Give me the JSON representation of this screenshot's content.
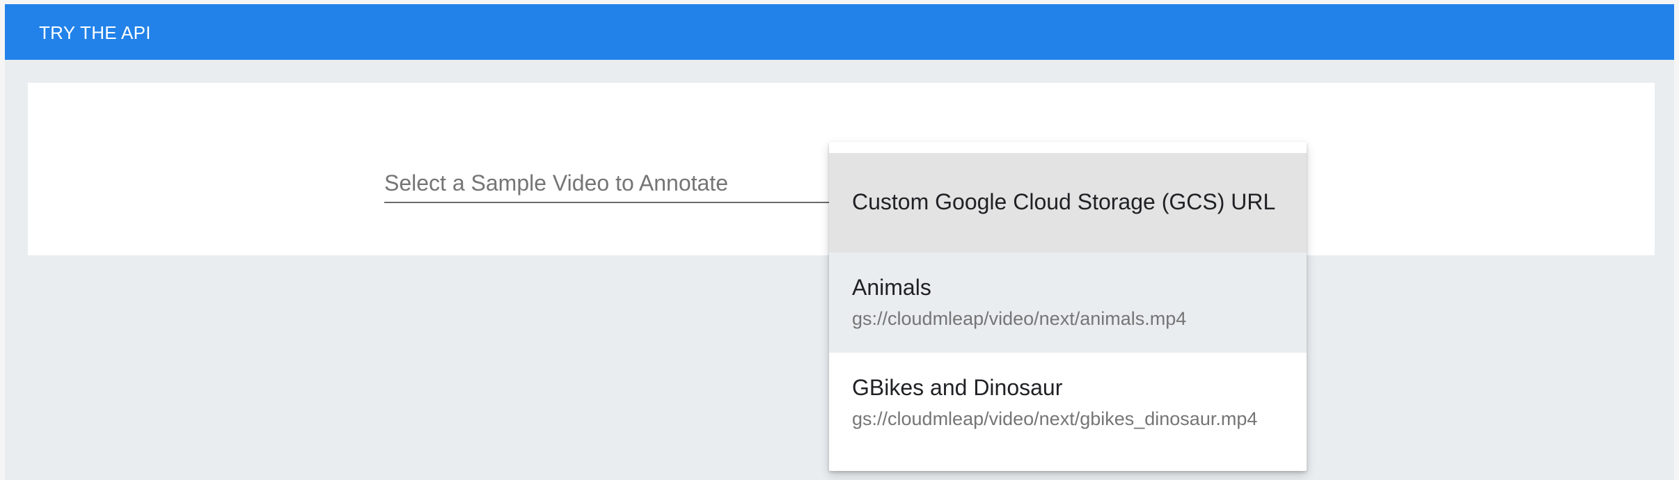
{
  "header": {
    "title": "TRY THE API"
  },
  "select": {
    "placeholder": "Select a Sample Video to Annotate"
  },
  "dropdown": {
    "options": [
      {
        "title": "Custom Google Cloud Storage (GCS) URL",
        "subtitle": ""
      },
      {
        "title": "Animals",
        "subtitle": "gs://cloudmleap/video/next/animals.mp4"
      },
      {
        "title": "GBikes and Dinosaur",
        "subtitle": "gs://cloudmleap/video/next/gbikes_dinosaur.mp4"
      }
    ]
  },
  "colors": {
    "header_blue": "#2282e9",
    "page_background": "#e9edf0",
    "highlight_option": "#e3e3e3"
  }
}
